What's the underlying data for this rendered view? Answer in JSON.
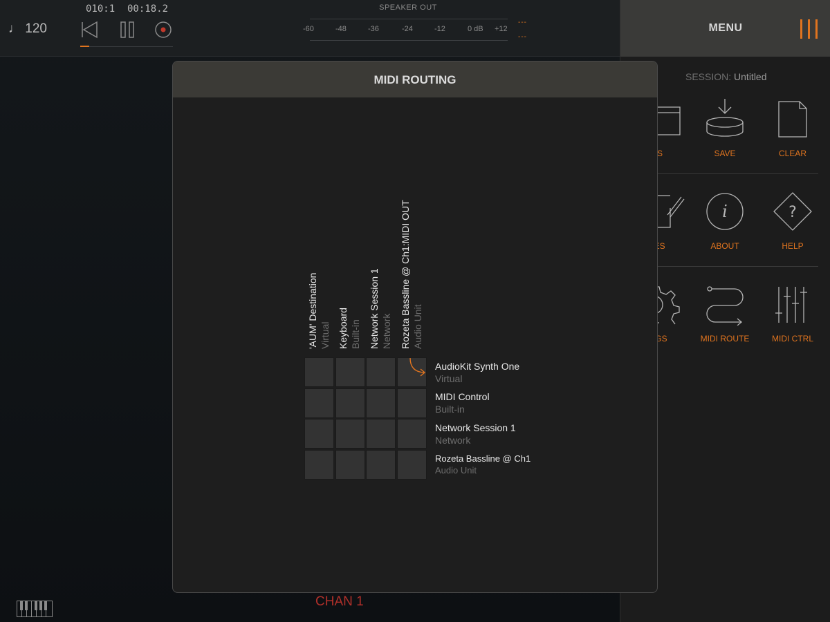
{
  "transport": {
    "tempo": "♩ 120",
    "position": "010:1",
    "clock": "00:18.2",
    "progress": 0.1
  },
  "meter": {
    "title": "SPEAKER OUT",
    "ticks": [
      "-60",
      "-48",
      "-36",
      "-24",
      "-12",
      "0 dB",
      "+12"
    ],
    "clip_top": "---",
    "clip_bottom": "---"
  },
  "menu": {
    "title": "MENU",
    "session_label": "SESSION:",
    "session_value": "Untitled",
    "items": [
      {
        "label": "ES",
        "icon": "folder-icon"
      },
      {
        "label": "SAVE",
        "icon": "save-icon"
      },
      {
        "label": "CLEAR",
        "icon": "clear-page-icon"
      },
      {
        "label": "TES",
        "icon": "notes-icon"
      },
      {
        "label": "ABOUT",
        "icon": "info-icon"
      },
      {
        "label": "HELP",
        "icon": "help-icon"
      },
      {
        "label": "INGS",
        "icon": "gear-icon"
      },
      {
        "label": "MIDI ROUTE",
        "icon": "midi-route-icon"
      },
      {
        "label": "MIDI CTRL",
        "icon": "sliders-icon"
      }
    ]
  },
  "modal": {
    "title": "MIDI ROUTING",
    "sources": [
      {
        "name": "'AUM' Destination",
        "type": "Virtual"
      },
      {
        "name": "Keyboard",
        "type": "Built-in"
      },
      {
        "name": "Network Session 1",
        "type": "Network"
      },
      {
        "name": "Rozeta Bassline @ Ch1:MIDI OUT",
        "type": "Audio Unit"
      }
    ],
    "destinations": [
      {
        "name": "AudioKit Synth One",
        "type": "Virtual"
      },
      {
        "name": "MIDI Control",
        "type": "Built-in"
      },
      {
        "name": "Network Session 1",
        "type": "Network"
      },
      {
        "name": "Rozeta Bassline @ Ch1",
        "type": "Audio Unit"
      }
    ]
  },
  "footer": {
    "channel": "CHAN 1"
  },
  "colors": {
    "accent": "#e0741f",
    "channel": "#b1302a"
  }
}
